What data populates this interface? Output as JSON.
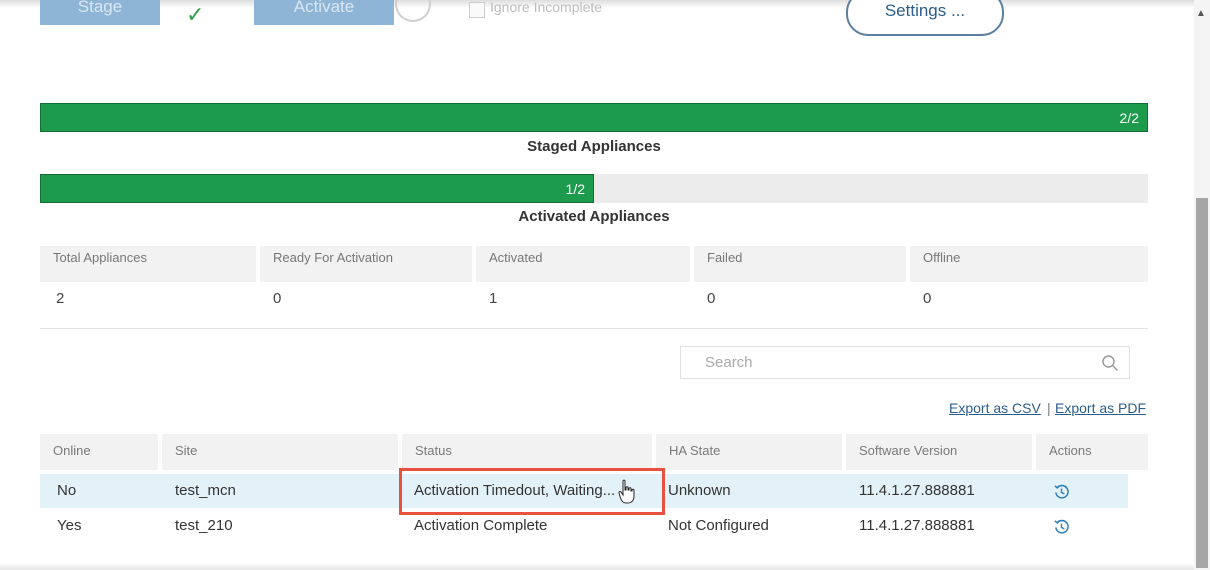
{
  "top": {
    "stage_label": "Stage",
    "activate_label": "Activate",
    "ignore_label": "Ignore Incomplete",
    "settings_label": "Settings ..."
  },
  "progress": {
    "staged": {
      "text": "2/2",
      "caption": "Staged Appliances",
      "fraction": 1.0
    },
    "activated": {
      "text": "1/2",
      "caption": "Activated Appliances",
      "fraction": 0.5
    }
  },
  "summary": {
    "headers": [
      "Total Appliances",
      "Ready For Activation",
      "Activated",
      "Failed",
      "Offline"
    ],
    "values": [
      "2",
      "0",
      "1",
      "0",
      "0"
    ]
  },
  "search": {
    "placeholder": "Search"
  },
  "export": {
    "csv": "Export as CSV",
    "sep": "|",
    "pdf": "Export as PDF"
  },
  "table": {
    "columns": [
      "Online",
      "Site",
      "Status",
      "HA State",
      "Software Version",
      "Actions"
    ],
    "rows": [
      {
        "online": "No",
        "site": "test_mcn",
        "status": "Activation Timedout, Waiting...",
        "ha_state": "Unknown",
        "version": "11.4.1.27.888881"
      },
      {
        "online": "Yes",
        "site": "test_210",
        "status": "Activation Complete",
        "ha_state": "Not Configured",
        "version": "11.4.1.27.888881"
      }
    ]
  },
  "colors": {
    "progress_green": "#1d9b4c",
    "highlight_row": "#e3f2f8",
    "annotation_red": "#e8513d",
    "link_blue": "#2a5d8c"
  },
  "icons": {
    "check": "checkmark-icon",
    "search": "search-icon",
    "action": "history-icon"
  }
}
